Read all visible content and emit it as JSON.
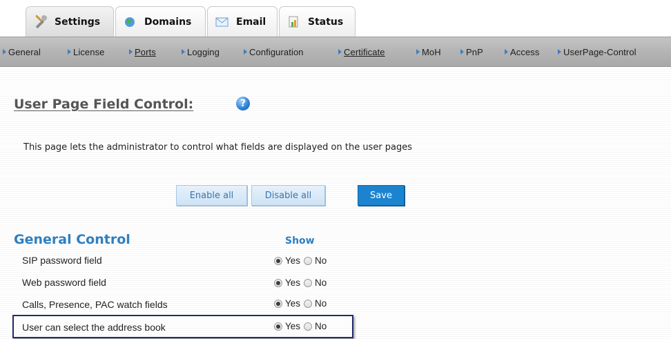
{
  "tabs": [
    {
      "label": "Settings",
      "icon": "settings-tools-icon"
    },
    {
      "label": "Domains",
      "icon": "globe-icon"
    },
    {
      "label": "Email",
      "icon": "envelope-icon"
    },
    {
      "label": "Status",
      "icon": "status-icon"
    }
  ],
  "nav": [
    {
      "label": "General",
      "link": false
    },
    {
      "label": "License",
      "link": false
    },
    {
      "label": "Ports",
      "link": true
    },
    {
      "label": "Logging",
      "link": false
    },
    {
      "label": "Configuration",
      "link": false
    },
    {
      "label": "Certificate",
      "link": true
    },
    {
      "label": "MoH",
      "link": false
    },
    {
      "label": "PnP",
      "link": false
    },
    {
      "label": "Access",
      "link": false
    },
    {
      "label": "UserPage-Control",
      "link": false
    }
  ],
  "page": {
    "title": "User Page Field Control:",
    "help_glyph": "?",
    "description": "This page lets the administrator to control what fields are displayed on the user pages"
  },
  "buttons": {
    "enable_all": "Enable all",
    "disable_all": "Disable all",
    "save": "Save"
  },
  "section": {
    "title": "General Control",
    "column_header": "Show",
    "yes_label": "Yes",
    "no_label": "No",
    "rows": [
      {
        "label": "SIP password field",
        "value": "Yes"
      },
      {
        "label": "Web password field",
        "value": "Yes"
      },
      {
        "label": "Calls, Presence, PAC watch fields",
        "value": "Yes"
      },
      {
        "label": "User can select the address book",
        "value": "Yes"
      }
    ]
  },
  "colors": {
    "accent_blue": "#2f7fc0",
    "save_button": "#1c83cf",
    "highlight_border": "#1f2b6b"
  }
}
